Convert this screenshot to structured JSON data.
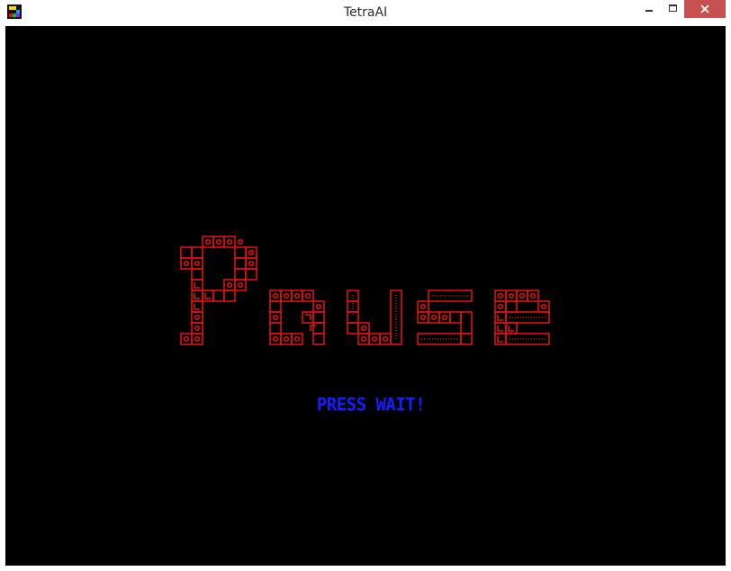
{
  "window": {
    "title": "TetraAI",
    "buttons": [
      "minimize",
      "maximize",
      "close"
    ]
  },
  "game": {
    "pause_text": "Pause",
    "prompt_text": "PRESS WAIT!",
    "colors": {
      "background": "#000000",
      "block_outline": "#e01010",
      "prompt": "#1020ff",
      "close_button": "#c75050"
    }
  }
}
